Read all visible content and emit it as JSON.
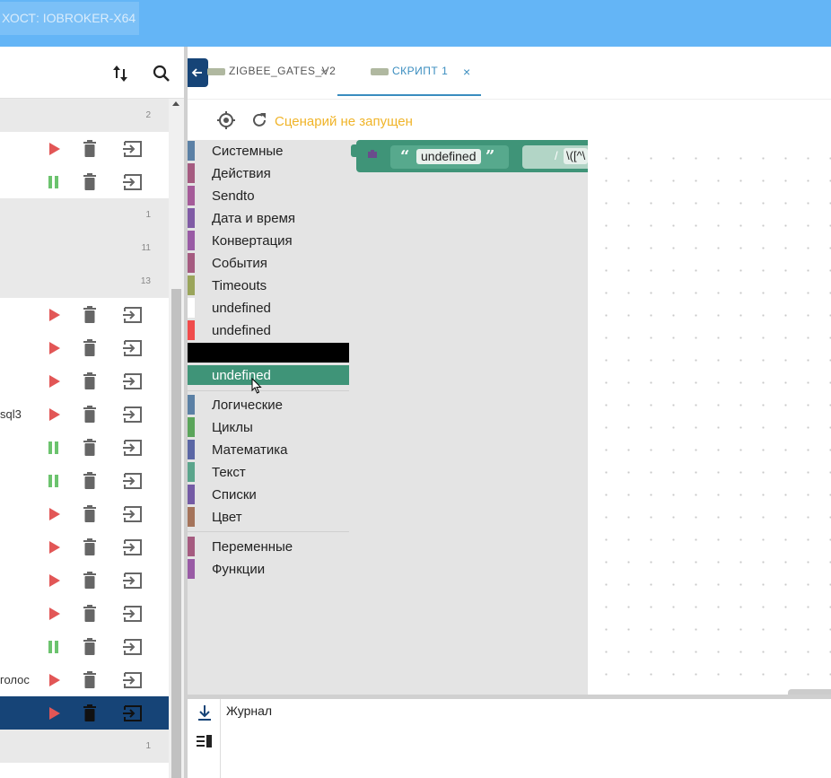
{
  "header": {
    "host": "ХОСТ: IOBROKER-X64",
    "accent": "#64b5f6"
  },
  "left_panel": {
    "rows": [
      {
        "kind": "group",
        "count": "2"
      },
      {
        "kind": "script",
        "name": "",
        "state": "stopped"
      },
      {
        "kind": "script",
        "name": "",
        "state": "running"
      },
      {
        "kind": "group",
        "count": "1"
      },
      {
        "kind": "group",
        "count": "11"
      },
      {
        "kind": "group",
        "count": "13"
      },
      {
        "kind": "script",
        "name": "",
        "state": "stopped"
      },
      {
        "kind": "script",
        "name": "",
        "state": "stopped"
      },
      {
        "kind": "script",
        "name": "",
        "state": "stopped"
      },
      {
        "kind": "script",
        "name": "sql3",
        "state": "stopped"
      },
      {
        "kind": "script",
        "name": "",
        "state": "running"
      },
      {
        "kind": "script",
        "name": "",
        "state": "running"
      },
      {
        "kind": "script",
        "name": "",
        "state": "stopped"
      },
      {
        "kind": "script",
        "name": "",
        "state": "stopped"
      },
      {
        "kind": "script",
        "name": "",
        "state": "stopped"
      },
      {
        "kind": "script",
        "name": "",
        "state": "stopped"
      },
      {
        "kind": "script",
        "name": "",
        "state": "running"
      },
      {
        "kind": "script",
        "name": "голос",
        "state": "stopped"
      },
      {
        "kind": "script",
        "name": "",
        "state": "stopped",
        "selected": true
      },
      {
        "kind": "group",
        "count": "1"
      }
    ]
  },
  "tabs": [
    {
      "label": "ZIGBEE_GATES_V2",
      "close": "×"
    },
    {
      "label": "СКРИПТ 1",
      "close": "×",
      "active": true
    }
  ],
  "editor": {
    "status": "Сценарий не запущен"
  },
  "toolbox": {
    "group1": [
      {
        "label": "Системные",
        "color": "#5b80a5"
      },
      {
        "label": "Действия",
        "color": "#a55b80"
      },
      {
        "label": "Sendto",
        "color": "#a55b99"
      },
      {
        "label": "Дата и время",
        "color": "#805ba5"
      },
      {
        "label": "Конвертация",
        "color": "#995ba5"
      },
      {
        "label": "События",
        "color": "#a55b80"
      },
      {
        "label": "Timeouts",
        "color": "#9aa55b"
      },
      {
        "label": "undefined",
        "color": "#ffffff"
      },
      {
        "label": "undefined",
        "color": "#f04c4c"
      }
    ],
    "black_item": {
      "label": "",
      "color": "#000000"
    },
    "selected_item": {
      "label": "undefined",
      "color": "#3f9478"
    },
    "group2": [
      {
        "label": "Логические",
        "color": "#5b80a5"
      },
      {
        "label": "Циклы",
        "color": "#5ba55b"
      },
      {
        "label": "Математика",
        "color": "#5b67a5"
      },
      {
        "label": "Текст",
        "color": "#5ba58c"
      },
      {
        "label": "Списки",
        "color": "#745ba5"
      },
      {
        "label": "Цвет",
        "color": "#a5745b"
      }
    ],
    "group3": [
      {
        "label": "Переменные",
        "color": "#a55b80"
      },
      {
        "label": "Функции",
        "color": "#995ba5"
      }
    ]
  },
  "block": {
    "string_value": "undefined",
    "open_quote": "“",
    "close_quote": "”",
    "slash": "/",
    "regex_value": "\\([^\\",
    "color": "#3f9478"
  },
  "log": {
    "title": "Журнал"
  }
}
